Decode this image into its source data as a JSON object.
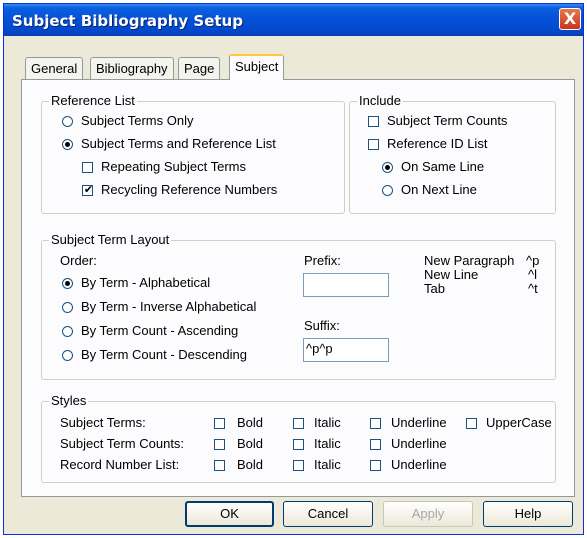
{
  "window": {
    "title": "Subject Bibliography Setup",
    "close_glyph": "X"
  },
  "tabs": [
    "General",
    "Bibliography",
    "Page",
    "Subject"
  ],
  "active_tab": "Subject",
  "reference_list": {
    "legend": "Reference List",
    "options": [
      {
        "label": "Subject Terms Only",
        "selected": false
      },
      {
        "label": "Subject Terms and Reference List",
        "selected": true
      }
    ],
    "checks": [
      {
        "label": "Repeating Subject Terms",
        "checked": false
      },
      {
        "label": "Recycling Reference Numbers",
        "checked": true
      }
    ]
  },
  "include": {
    "legend": "Include",
    "checks": [
      {
        "label": "Subject Term Counts",
        "checked": false
      },
      {
        "label": "Reference ID List",
        "checked": false
      }
    ],
    "options": [
      {
        "label": "On Same Line",
        "selected": true
      },
      {
        "label": "On Next Line",
        "selected": false
      }
    ]
  },
  "layout": {
    "legend": "Subject Term Layout",
    "order_label": "Order:",
    "options": [
      {
        "label": "By Term - Alphabetical",
        "selected": true
      },
      {
        "label": "By Term - Inverse Alphabetical",
        "selected": false
      },
      {
        "label": "By Term Count - Ascending",
        "selected": false
      },
      {
        "label": "By Term Count - Descending",
        "selected": false
      }
    ],
    "prefix_label": "Prefix:",
    "prefix_value": "",
    "suffix_label": "Suffix:",
    "suffix_value": "^p^p",
    "codes": [
      {
        "name": "New Paragraph",
        "code": "^p"
      },
      {
        "name": "New Line",
        "code": "^l"
      },
      {
        "name": "Tab",
        "code": "^t"
      }
    ]
  },
  "styles": {
    "legend": "Styles",
    "rows": [
      {
        "label": "Subject Terms:",
        "options": [
          {
            "label": "Bold",
            "checked": false
          },
          {
            "label": "Italic",
            "checked": false
          },
          {
            "label": "Underline",
            "checked": false
          },
          {
            "label": "UpperCase",
            "checked": false
          }
        ]
      },
      {
        "label": "Subject Term Counts:",
        "options": [
          {
            "label": "Bold",
            "checked": false
          },
          {
            "label": "Italic",
            "checked": false
          },
          {
            "label": "Underline",
            "checked": false
          }
        ]
      },
      {
        "label": "Record Number List:",
        "options": [
          {
            "label": "Bold",
            "checked": false
          },
          {
            "label": "Italic",
            "checked": false
          },
          {
            "label": "Underline",
            "checked": false
          }
        ]
      }
    ]
  },
  "buttons": {
    "ok": "OK",
    "cancel": "Cancel",
    "apply": "Apply",
    "help": "Help"
  },
  "check_glyph": "✔"
}
